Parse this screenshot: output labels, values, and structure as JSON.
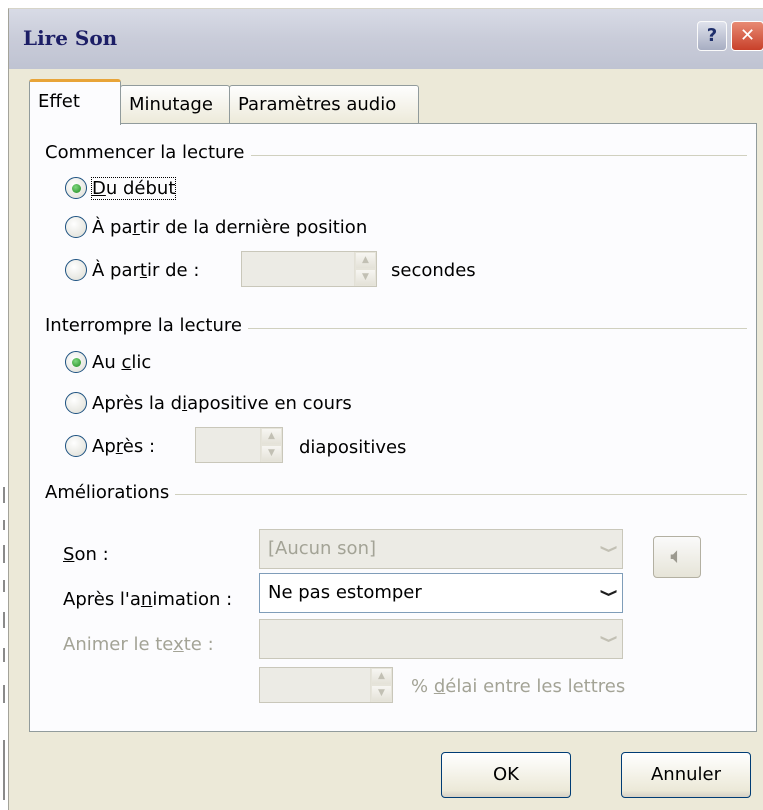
{
  "window": {
    "title": "Lire Son",
    "help_label": "?",
    "close_label": "x"
  },
  "tabs": [
    {
      "label": "Effet",
      "active": true
    },
    {
      "label": "Minutage",
      "active": false
    },
    {
      "label": "Paramètres audio",
      "active": false
    }
  ],
  "start_group": {
    "title": "Commencer la lecture",
    "options": [
      {
        "pre": "",
        "u": "D",
        "post": "u début",
        "checked": true
      },
      {
        "pre": "À pa",
        "u": "r",
        "post": "tir de la dernière position",
        "checked": false
      },
      {
        "pre": "À par",
        "u": "t",
        "post": "ir de :",
        "checked": false
      }
    ],
    "seconds_value": "",
    "seconds_unit": "secondes"
  },
  "stop_group": {
    "title": "Interrompre la lecture",
    "options": [
      {
        "pre": "Au ",
        "u": "c",
        "post": "lic",
        "checked": true
      },
      {
        "pre": "Après la d",
        "u": "i",
        "post": "apositive en cours",
        "checked": false
      },
      {
        "pre": "Ap",
        "u": "r",
        "post": "ès :",
        "checked": false
      }
    ],
    "slides_value": "",
    "slides_unit": "diapositives"
  },
  "enhancements": {
    "title": "Améliorations",
    "sound_label_u": "S",
    "sound_label_rest": "on :",
    "sound_value": "[Aucun son]",
    "after_anim_label_pre": "Après l'a",
    "after_anim_label_u": "n",
    "after_anim_label_post": "imation :",
    "after_anim_value": "Ne pas estomper",
    "animate_text_label_pre": "Animer le te",
    "animate_text_label_u": "x",
    "animate_text_label_post": "te :",
    "animate_text_value": "",
    "delay_value": "",
    "delay_label_pre": "% ",
    "delay_label_u": "d",
    "delay_label_post": "élai entre les lettres"
  },
  "buttons": {
    "ok": "OK",
    "cancel": "Annuler"
  },
  "icons": {
    "speaker": "speaker-icon",
    "spin_up": "▲",
    "spin_down": "▼",
    "dropdown": "❯"
  }
}
